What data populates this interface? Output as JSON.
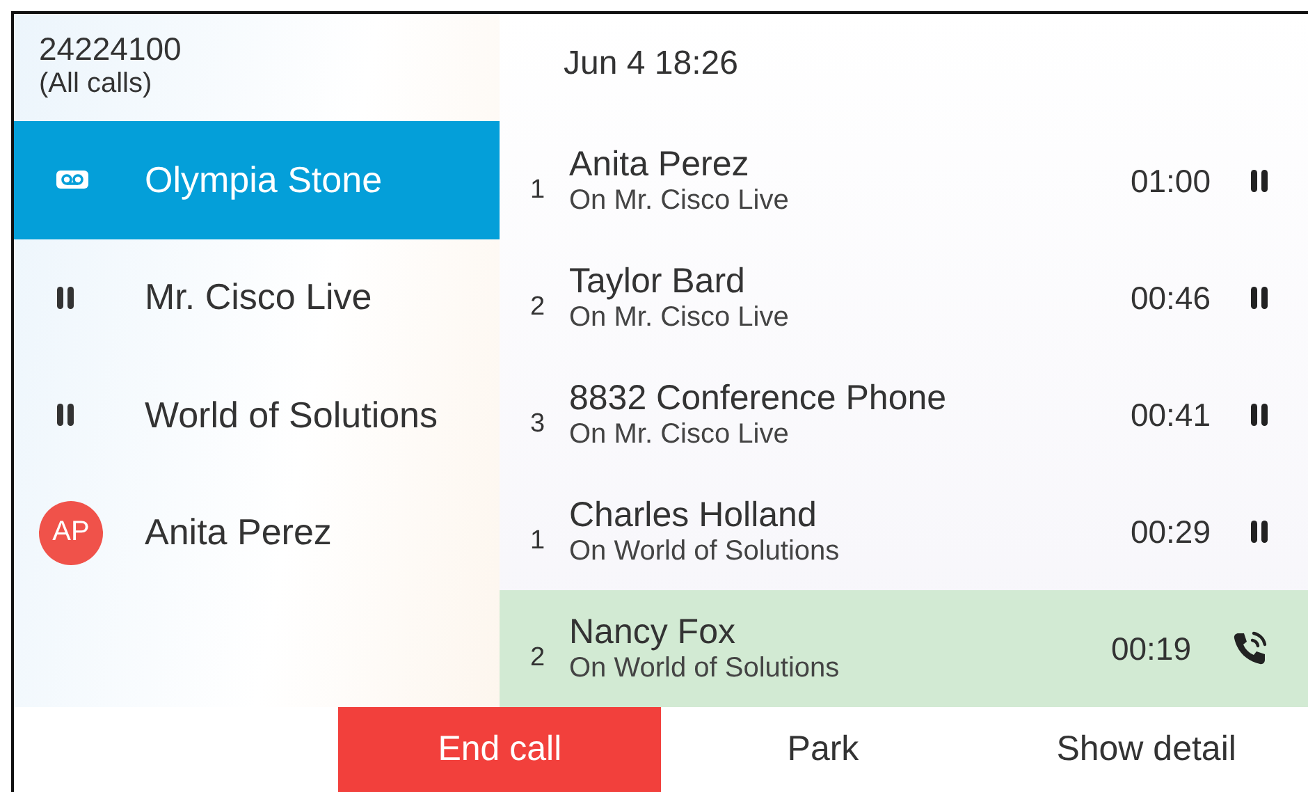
{
  "line": {
    "number": "24224100",
    "filter": "(All calls)"
  },
  "datetime": "Jun 4 18:26",
  "sessions": [
    {
      "name": "Olympia Stone",
      "kind": "voicemail",
      "selected": true
    },
    {
      "name": "Mr. Cisco Live",
      "kind": "hold",
      "selected": false
    },
    {
      "name": "World of Solutions",
      "kind": "hold",
      "selected": false
    },
    {
      "name": "Anita Perez",
      "kind": "avatar",
      "initials": "AP",
      "color": "#f0524a",
      "selected": false
    }
  ],
  "calls": [
    {
      "index": "1",
      "name": "Anita Perez",
      "detail": "On Mr. Cisco Live",
      "duration": "01:00",
      "kind": "hold",
      "selected": false
    },
    {
      "index": "2",
      "name": "Taylor Bard",
      "detail": "On Mr. Cisco Live",
      "duration": "00:46",
      "kind": "hold",
      "selected": false
    },
    {
      "index": "3",
      "name": "8832 Conference Phone",
      "detail": "On Mr. Cisco Live",
      "duration": "00:41",
      "kind": "hold",
      "selected": false
    },
    {
      "index": "1",
      "name": "Charles Holland",
      "detail": "On World of Solutions",
      "duration": "00:29",
      "kind": "hold",
      "selected": false
    },
    {
      "index": "2",
      "name": "Nancy Fox",
      "detail": "On World of Solutions",
      "duration": "00:19",
      "kind": "active",
      "selected": true
    }
  ],
  "softkeys": [
    {
      "label": "End call",
      "kind": "danger"
    },
    {
      "label": "Park",
      "kind": "plain"
    },
    {
      "label": "Show detail",
      "kind": "plain"
    }
  ]
}
